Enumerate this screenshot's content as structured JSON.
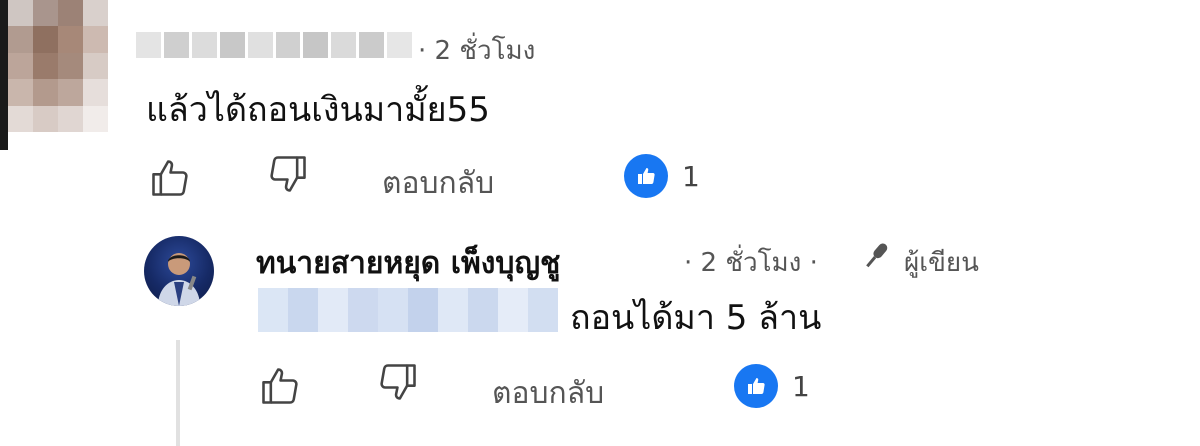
{
  "comment1": {
    "author_name_blurred": true,
    "time": "· 2 ชั่วโมง",
    "text": "แล้วได้ถอนเงินมามั้ย55",
    "actions": {
      "like_icon": "thumbs-up-icon",
      "dislike_icon": "thumbs-down-icon",
      "reply_label": "ตอบกลับ",
      "like_count": "1"
    }
  },
  "reply1": {
    "author_name": "ทนายสายหยุด เพ็งบุญชู",
    "time": "· 2 ชั่วโมง ·",
    "badge_label": "ผู้เขียน",
    "badge_icon": "microphone-icon",
    "mention_blurred": true,
    "text": "ถอนได้มา 5 ล้าน",
    "actions": {
      "like_icon": "thumbs-up-icon",
      "dislike_icon": "thumbs-down-icon",
      "reply_label": "ตอบกลับ",
      "like_count": "1"
    }
  },
  "colors": {
    "like_badge": "#1877f2",
    "meta_text": "#555555",
    "text": "#111111"
  }
}
